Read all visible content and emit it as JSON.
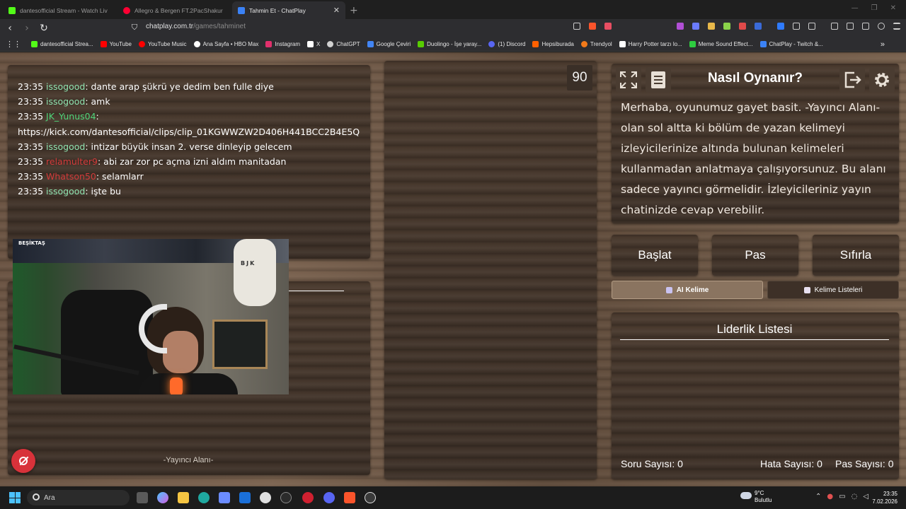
{
  "browser": {
    "tabs": [
      {
        "title": "dantesofficial Stream - Watch Liv",
        "color": "#53fc18"
      },
      {
        "title": "Allegro & Bergen FT.2PacShakur",
        "color": "#ff0033"
      },
      {
        "title": "Tahmin Et - ChatPlay",
        "color": "#3b82f6",
        "active": true
      }
    ],
    "new_tab": "+",
    "url_domain": "chatplay.com.tr",
    "url_path": "/games/tahminet",
    "bookmarks": [
      {
        "label": "dantesofficial Strea...",
        "color": "#53fc18"
      },
      {
        "label": "YouTube",
        "color": "#ff0000"
      },
      {
        "label": "YouTube Music",
        "color": "#ff0000"
      },
      {
        "label": "Ana Sayfa • HBO Max",
        "color": "#ffffff"
      },
      {
        "label": "Instagram",
        "color": "#e1306c"
      },
      {
        "label": "X",
        "color": "#ffffff"
      },
      {
        "label": "ChatGPT",
        "color": "#d0d0d0"
      },
      {
        "label": "Google Çeviri",
        "color": "#4285f4"
      },
      {
        "label": "Duolingo - İşe yaray...",
        "color": "#58cc02"
      },
      {
        "label": "(1) Discord",
        "color": "#5865f2"
      },
      {
        "label": "Hepsiburada",
        "color": "#ff6000"
      },
      {
        "label": "Trendyol",
        "color": "#f27a1a"
      },
      {
        "label": "Harry Potter tarzı lo...",
        "color": "#ffffff"
      },
      {
        "label": "Meme Sound Effect...",
        "color": "#2ecc40"
      },
      {
        "label": "ChatPlay - Twitch &...",
        "color": "#3b82f6"
      }
    ],
    "more": "»"
  },
  "chat": {
    "messages": [
      {
        "time": "23:35",
        "user": "issogood",
        "color": "#8fe3b0",
        "text": ": dante arap şükrü ye dedim ben fulle diye"
      },
      {
        "time": "23:35",
        "user": "issogood",
        "color": "#8fe3b0",
        "text": ": amk"
      },
      {
        "time": "23:35",
        "user": "JK_Yunus04",
        "color": "#4fd67a",
        "text": ":"
      },
      {
        "time": "",
        "user": "",
        "color": "#ffffff",
        "text": "https://kick.com/dantesofficial/clips/clip_01KGWWZW2D406H441BCC2B4E5Q"
      },
      {
        "time": "23:35",
        "user": "issogood",
        "color": "#8fe3b0",
        "text": ": intizar büyük insan 2. verse dinleyip gelecem"
      },
      {
        "time": "23:35",
        "user": "relamulter9",
        "color": "#d23a3a",
        "text": ": abi zar zor pc açma izni aldım manitadan"
      },
      {
        "time": "23:35",
        "user": "Whatson50",
        "color": "#d23a3a",
        "text": ": selamlarr"
      },
      {
        "time": "23:35",
        "user": "issogood",
        "color": "#8fe3b0",
        "text": ": işte bu"
      }
    ]
  },
  "webcam": {
    "shelf_text": "BEŞİKTAŞ",
    "badge_text": "BJK"
  },
  "streamer_area_label": "-Yayıncı Alanı-",
  "timer": "90",
  "how_to": {
    "title": "Nasıl Oynanır?",
    "text": "Merhaba, oyunumuz gayet basit. -Yayıncı Alanı- olan sol altta ki bölüm de yazan kelimeyi izleyicilerinize altında bulunan kelimeleri kullanmadan anlatmaya çalışıyorsunuz. Bu alanı sadece yayıncı görmelidir. İzleyicileriniz yayın chatinizde cevap verebilir."
  },
  "buttons": {
    "start": "Başlat",
    "pass": "Pas",
    "reset": "Sıfırla",
    "ai_word": "AI Kelime",
    "word_lists": "Kelime Listeleri"
  },
  "leaderboard": {
    "title": "Liderlik Listesi"
  },
  "stats": {
    "questions": "Soru Sayısı: 0",
    "errors": "Hata Sayısı: 0",
    "passes": "Pas Sayısı: 0"
  },
  "taskbar": {
    "search_placeholder": "Ara",
    "weather_temp": "9°C",
    "weather_desc": "Bulutlu",
    "time": "23:35",
    "date": "7.02.2026"
  }
}
